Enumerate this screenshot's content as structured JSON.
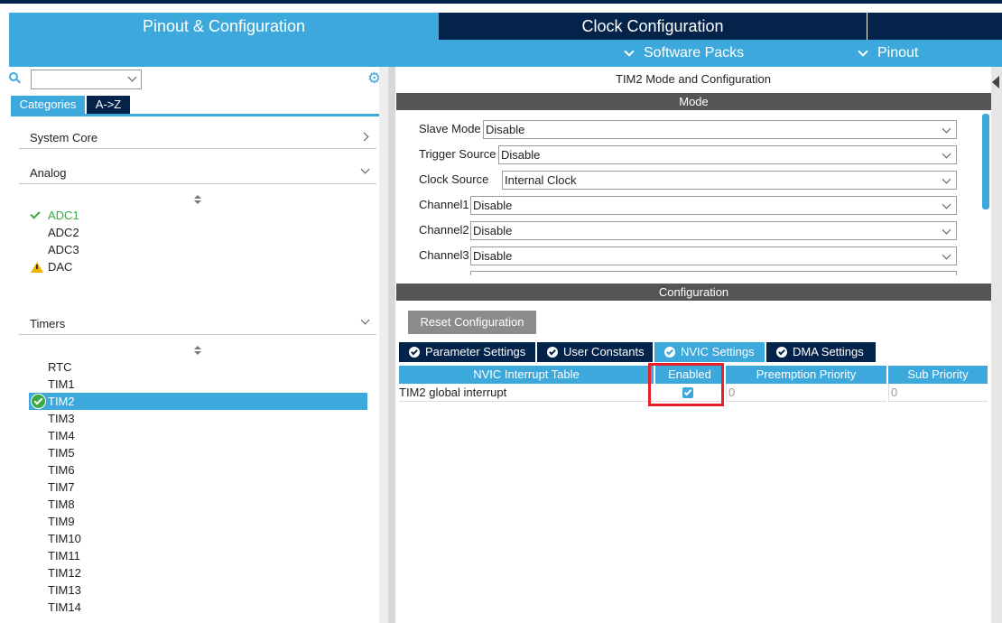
{
  "tabs": {
    "pinout": "Pinout & Configuration",
    "clock": "Clock Configuration"
  },
  "subbar": {
    "software_packs": "Software Packs",
    "pinout": "Pinout"
  },
  "left": {
    "search_value": "",
    "category_tabs": [
      "Categories",
      "A->Z"
    ],
    "groups": {
      "system_core": "System Core",
      "analog": "Analog",
      "timers": "Timers"
    },
    "analog_items": [
      {
        "label": "ADC1",
        "status": "ok"
      },
      {
        "label": "ADC2",
        "status": "none"
      },
      {
        "label": "ADC3",
        "status": "none"
      },
      {
        "label": "DAC",
        "status": "warning"
      }
    ],
    "timer_items": [
      "RTC",
      "TIM1",
      "TIM2",
      "TIM3",
      "TIM4",
      "TIM5",
      "TIM6",
      "TIM7",
      "TIM8",
      "TIM9",
      "TIM10",
      "TIM11",
      "TIM12",
      "TIM13",
      "TIM14"
    ],
    "selected_timer": "TIM2"
  },
  "right": {
    "title": "TIM2 Mode and Configuration",
    "mode_header": "Mode",
    "mode_rows": [
      {
        "label": "Slave Mode",
        "value": "Disable"
      },
      {
        "label": "Trigger Source",
        "value": "Disable"
      },
      {
        "label": "Clock Source",
        "value": "Internal Clock"
      },
      {
        "label": "Channel1",
        "value": "Disable"
      },
      {
        "label": "Channel2",
        "value": "Disable"
      },
      {
        "label": "Channel3",
        "value": "Disable"
      }
    ],
    "configuration_header": "Configuration",
    "reset_button": "Reset Configuration",
    "config_tabs": [
      {
        "label": "Parameter Settings",
        "active": false
      },
      {
        "label": "User Constants",
        "active": false
      },
      {
        "label": "NVIC Settings",
        "active": true
      },
      {
        "label": "DMA Settings",
        "active": false
      }
    ],
    "nvic_table": {
      "headers": [
        "NVIC Interrupt Table",
        "Enabled",
        "Preemption Priority",
        "Sub Priority"
      ],
      "rows": [
        {
          "name": "TIM2 global interrupt",
          "enabled": true,
          "preemption": "0",
          "sub": "0"
        }
      ]
    }
  },
  "colors": {
    "accent": "#3ca8dc",
    "dark": "#03234b",
    "highlight": "#e8202a",
    "ok": "#3aa845",
    "warning": "#f0b400"
  }
}
